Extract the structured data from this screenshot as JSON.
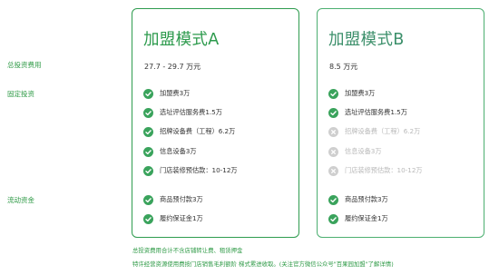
{
  "labels": {
    "total": "总投资费用",
    "fixed": "固定投资",
    "working": "流动资金"
  },
  "plans": [
    {
      "title": "加盟模式A",
      "total": "27.7 - 29.7 万元",
      "fixed": [
        {
          "text": "加盟费3万",
          "included": true
        },
        {
          "text": "选址评估服务费1.5万",
          "included": true
        },
        {
          "text": "招牌设备费（工程）6.2万",
          "included": true
        },
        {
          "text": "信息设备3万",
          "included": true
        },
        {
          "text": "门店装修预估款：10-12万",
          "included": true
        }
      ],
      "working": [
        {
          "text": "商品预付款3万",
          "included": true
        },
        {
          "text": "履约保证金1万",
          "included": true
        }
      ]
    },
    {
      "title": "加盟模式B",
      "total": "8.5 万元",
      "fixed": [
        {
          "text": "加盟费3万",
          "included": true
        },
        {
          "text": "选址评估服务费1.5万",
          "included": true
        },
        {
          "text": "招牌设备费（工程）6.2万",
          "included": false
        },
        {
          "text": "信息设备3万",
          "included": false
        },
        {
          "text": "门店装修预估款：10-12万",
          "included": false
        }
      ],
      "working": [
        {
          "text": "商品预付款3万",
          "included": true
        },
        {
          "text": "履约保证金1万",
          "included": true
        }
      ]
    }
  ],
  "notes": [
    "总投资费用合计不含店铺转让费、租赁押金",
    "特许经营资源使用费按门店销售毛利额阶 梯式累进收取。(关注官方微信公众号\"百果园加盟\"了解详情)"
  ],
  "icons": {
    "included": "check-circle-icon",
    "excluded": "cross-circle-icon"
  },
  "colors": {
    "accent": "#2e9a46",
    "check": "#3aa35c",
    "disabled": "#cfcfcf"
  }
}
